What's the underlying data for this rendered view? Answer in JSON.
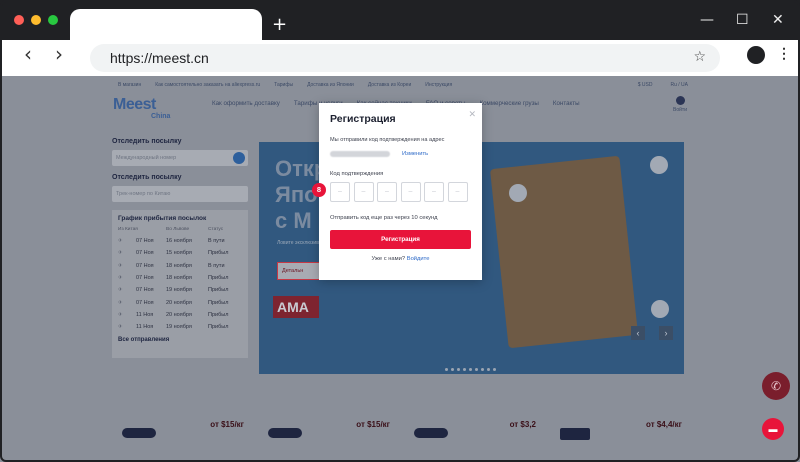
{
  "browser": {
    "url": "https://meest.cn",
    "new_tab": "+",
    "win_minimize": "—",
    "win_maximize": "☐",
    "win_close": "✕",
    "back": "‹",
    "forward": "›",
    "bookmark": "☆",
    "menu": "⋮",
    "traffic_lights": [
      "#ff5f57",
      "#febc2e",
      "#28c840"
    ]
  },
  "site": {
    "topbar_left": [
      "В магазин",
      "Как самостоятельно заказать на aliexpress.ru",
      "Тарифы",
      "Доставка из Японии",
      "Доставка из Кореи",
      "Инструкция"
    ],
    "topbar_right": [
      "$ USD",
      "Ru / UA"
    ],
    "logo": "Meest",
    "logo_sub": "China",
    "nav": [
      "Как оформить доставку",
      "Тарифы и услуги",
      "Как сейчас техники",
      "FAQ и советы",
      "Коммерческие грузы",
      "Контакты"
    ],
    "login": "Войти",
    "track_title": "Отследить посылку",
    "track_placeholder": "Международный номер",
    "track_title2": "Отследить посылку",
    "track_placeholder2": "Трек-номер по Китаю",
    "schedule_title": "График прибытия посылок",
    "schedule_head": [
      "Из Китая",
      "Во Львове",
      "Статус"
    ],
    "schedule_rows": [
      [
        "07 Ноя",
        "16 ноября",
        "В пути"
      ],
      [
        "07 Ноя",
        "15 ноября",
        "Прибыл"
      ],
      [
        "07 Ноя",
        "18 ноября",
        "В пути"
      ],
      [
        "07 Ноя",
        "18 ноября",
        "Прибыл"
      ],
      [
        "07 Ноя",
        "19 ноября",
        "Прибыл"
      ],
      [
        "07 Ноя",
        "20 ноября",
        "Прибыл"
      ],
      [
        "11 Ноя",
        "20 ноября",
        "Прибыл"
      ],
      [
        "11 Ноя",
        "19 ноября",
        "Прибыл"
      ]
    ],
    "all_shipments": "Все отправления",
    "banner_line1": "Открывайте",
    "banner_line2": "Япо",
    "banner_line3": "с М",
    "banner_small": "Ловите эксклюзивные товары",
    "banner_button": "Детальн",
    "banner_tag": "AMA",
    "prices": [
      "от $15/кг",
      "от $15/кг",
      "от $3,2",
      "от $4,4/кг"
    ]
  },
  "modal": {
    "title": "Регистрация",
    "close": "✕",
    "sent_text": "Мы отправили код подтверждения на адрес",
    "change_link": "Изменить",
    "code_label": "Код подтверждения",
    "step_badge": "8",
    "code_placeholder": "–",
    "resend_text": "Отправить код еще раз через 10 секунд",
    "submit": "Регистрация",
    "have_account": "Уже с нами?",
    "login_link": "Войдите"
  }
}
